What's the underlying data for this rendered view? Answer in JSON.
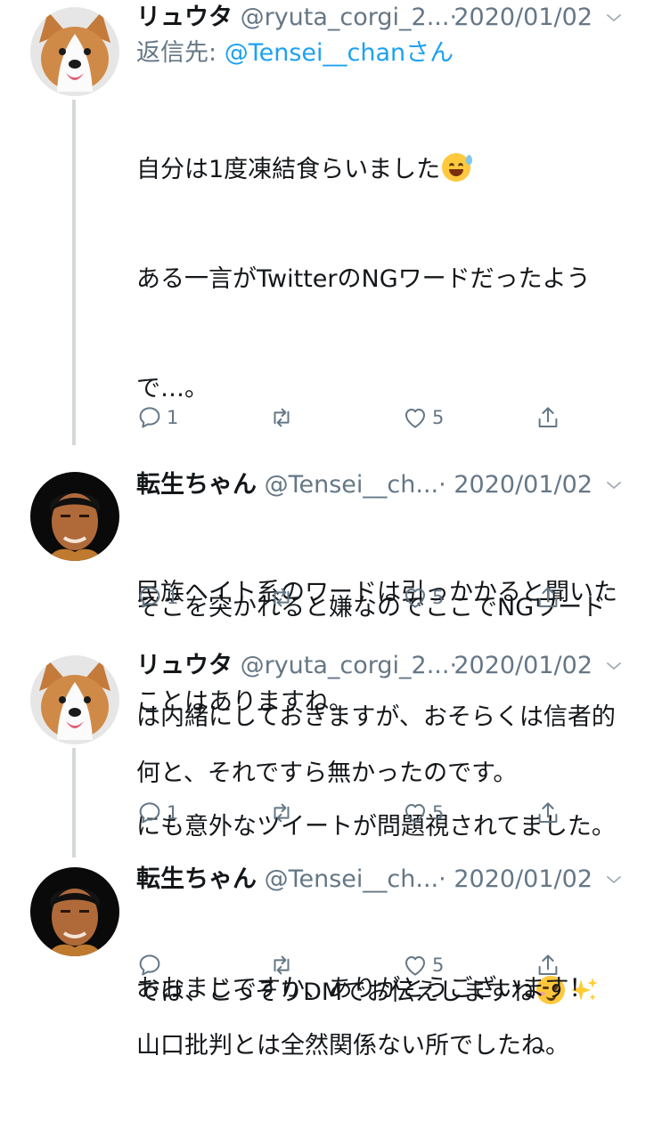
{
  "tweets": [
    {
      "name": "リュウタ",
      "handle": "@ryuta_corgi_2...",
      "separator": "·",
      "date": "2020/01/02",
      "replying_prefix": "返信先: ",
      "replying_mention": "@Tensei__chan",
      "replying_suffix": "さん",
      "lines": [
        "自分は1度凍結食らいました",
        "ある一言がTwitterのNGワードだったよう",
        "で…。",
        "",
        "そこを突かれると嫌なのでここでNGワード",
        "は内緒にしておきますが、おそらくは信者的",
        "にも意外なツイートが問題視されてました。",
        "",
        "山口批判とは全然関係ない所でしたね。"
      ],
      "reply_count": "1",
      "retweet_count": "",
      "like_count": "5",
      "avatar": "corgi"
    },
    {
      "name": "転生ちゃん",
      "handle": "@Tensei__ch...",
      "separator": "·",
      "date": "2020/01/02",
      "lines": [
        "民族ヘイト系のワードは引っかかると聞いた",
        "ことはありますね。"
      ],
      "reply_count": "1",
      "retweet_count": "",
      "like_count": "5",
      "avatar": "man"
    },
    {
      "name": "リュウタ",
      "handle": "@ryuta_corgi_2...",
      "separator": "·",
      "date": "2020/01/02",
      "lines": [
        "何と、それですら無かったのです。",
        "",
        "では、こっそりDMでお伝えしますね"
      ],
      "reply_count": "1",
      "retweet_count": "",
      "like_count": "5",
      "avatar": "corgi"
    },
    {
      "name": "転生ちゃん",
      "handle": "@Tensei__ch...",
      "separator": "·",
      "date": "2020/01/02",
      "lines": [
        "おおまじですか、ありがとうございます！"
      ],
      "reply_count": "",
      "retweet_count": "",
      "like_count": "5",
      "avatar": "man"
    }
  ],
  "icons": {
    "reply": "reply-icon",
    "retweet": "retweet-icon",
    "like": "heart-icon",
    "share": "share-icon",
    "caret": "chevron-down-icon",
    "emoji_1": "grinning-sweat-emoji-icon",
    "emoji_3a": "winking-face-emoji-icon",
    "emoji_3b": "sparkles-icon"
  },
  "colors": {
    "text": "#14171a",
    "secondary": "#657786",
    "mention": "#1da1f2",
    "thread_line": "#d5d8db"
  }
}
